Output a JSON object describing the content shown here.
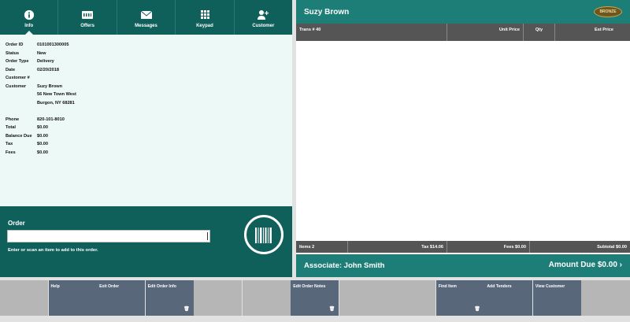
{
  "tabs": [
    {
      "label": "Info",
      "icon": "info-icon",
      "active": true
    },
    {
      "label": "Offers",
      "icon": "offers-icon",
      "active": false
    },
    {
      "label": "Messages",
      "icon": "envelope-icon",
      "active": false
    },
    {
      "label": "Keypad",
      "icon": "keypad-icon",
      "active": false
    },
    {
      "label": "Customer",
      "icon": "add-customer-icon",
      "active": false
    }
  ],
  "details": [
    {
      "key": "Order ID",
      "value": "0101001300005"
    },
    {
      "key": "Status",
      "value": "New"
    },
    {
      "key": "Order Type",
      "value": "Delivery"
    },
    {
      "key": "Date",
      "value": "02/20/2018"
    },
    {
      "key": "Customer #",
      "value": ""
    },
    {
      "key": "Customer",
      "value": "Suzy Brown"
    },
    {
      "key": "",
      "value": "56 New Town West"
    },
    {
      "key": "",
      "value": "Burgon, NY 68281"
    },
    {
      "key": "",
      "value": ""
    },
    {
      "key": "Phone",
      "value": "820-101-8010"
    },
    {
      "key": "Total",
      "value": "$0.00"
    },
    {
      "key": "Balance Due",
      "value": "$0.00"
    },
    {
      "key": "Tax",
      "value": "$0.00"
    },
    {
      "key": "Fees",
      "value": "$0.00"
    }
  ],
  "order": {
    "title": "Order",
    "input_value": "",
    "hint": "Enter or scan an item to add to this order."
  },
  "right": {
    "customer_name": "Suzy Brown",
    "badge": "BRONZE",
    "columns": {
      "trans": "Trans # 40",
      "unit": "Unit Price",
      "qty": "Qty",
      "est": "Est Price"
    },
    "totals": {
      "items": "Items 2",
      "tax": "Tax $14.06",
      "fees": "Fees $0.00",
      "subtotal": "Subtotal $0.00"
    },
    "associate": "Associate: John Smith",
    "amount_due": "Amount Due  $0.00  ›"
  },
  "footer": [
    {
      "label": "",
      "enabled": false,
      "trash": false
    },
    {
      "label": "Help",
      "enabled": true,
      "trash": false
    },
    {
      "label": "Exit Order",
      "enabled": true,
      "trash": false
    },
    {
      "label": "Edit Order Info",
      "enabled": true,
      "trash": true
    },
    {
      "label": "",
      "enabled": false,
      "trash": false
    },
    {
      "label": "",
      "enabled": false,
      "trash": false
    },
    {
      "label": "Edit Order Notes",
      "enabled": true,
      "trash": true
    },
    {
      "label": "",
      "enabled": false,
      "trash": false
    },
    {
      "label": "",
      "enabled": false,
      "trash": false
    },
    {
      "label": "Find Item",
      "enabled": true,
      "trash": true
    },
    {
      "label": "Add Tenders",
      "enabled": true,
      "trash": false
    },
    {
      "label": "View Customer",
      "enabled": true,
      "trash": false
    },
    {
      "label": "",
      "enabled": false,
      "trash": false
    }
  ],
  "colors": {
    "teal_dark": "#0f5f5b",
    "teal": "#1d7d77",
    "footer_enabled": "#58687a",
    "footer_disabled": "#b6b6b6",
    "header_gray": "#555555"
  }
}
